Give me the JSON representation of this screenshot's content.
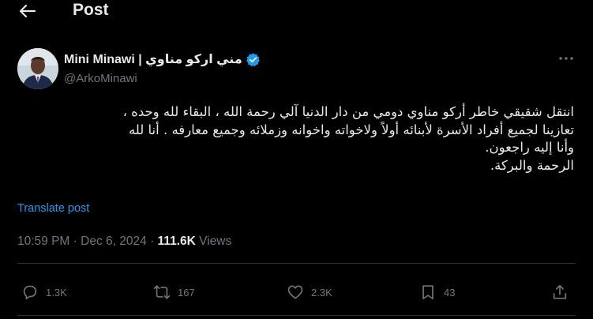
{
  "header": {
    "title": "Post"
  },
  "author": {
    "name": "Mini Minawi | مني اركو مناوي",
    "handle": "@ArkoMinawi"
  },
  "post": {
    "lines": [
      "انتقل شقيقي خاطر أركو مناوي دومي من دار الدنيا آلي رحمة الله ، البقاء لله وحده ،",
      "تعازينا لجميع أفراد الأسرة  لأبنائه أولاً ولاخواته واخوانه وزملائه وجميع معارفه . أنا لله",
      "وأنا إليه راجعون.",
      "الرحمة والبركة."
    ],
    "translate_label": "Translate post",
    "time": "10:59 PM",
    "separator": "·",
    "date": "Dec 6, 2024",
    "views_count": "111.6K",
    "views_label": "Views"
  },
  "actions": {
    "replies": "1.3K",
    "reposts": "167",
    "likes": "2.3K",
    "bookmarks": "43"
  },
  "colors": {
    "background": "#000000",
    "text": "#e7e9ea",
    "secondary": "#71767b",
    "accent": "#1d9bf0",
    "divider": "#2f3336"
  },
  "icons": {
    "back": "arrow-left-icon",
    "verified": "verified-badge-icon",
    "more": "more-dots-icon",
    "reply": "reply-icon",
    "repost": "repost-icon",
    "like": "heart-icon",
    "bookmark": "bookmark-icon",
    "share": "share-icon"
  }
}
